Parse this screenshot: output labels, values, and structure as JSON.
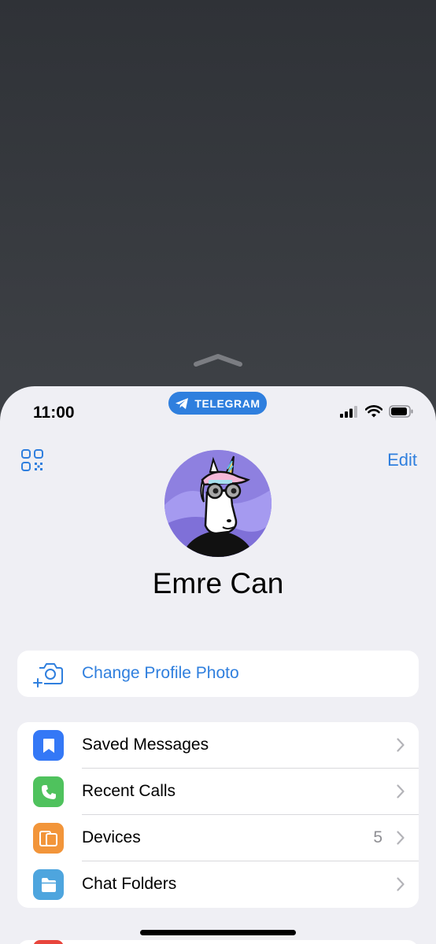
{
  "status_bar": {
    "time": "11:00",
    "app_name": "TELEGRAM"
  },
  "header": {
    "qr_icon": "qr-code-icon",
    "edit_label": "Edit"
  },
  "profile": {
    "name": "Emre Can"
  },
  "change_photo": {
    "label": "Change Profile Photo",
    "icon": "camera-add-icon"
  },
  "menu": {
    "items": [
      {
        "label": "Saved Messages",
        "icon": "bookmark-icon",
        "color": "#3478f6"
      },
      {
        "label": "Recent Calls",
        "icon": "phone-icon",
        "color": "#4fc25d"
      },
      {
        "label": "Devices",
        "icon": "devices-icon",
        "color": "#f2953a",
        "count": "5"
      },
      {
        "label": "Chat Folders",
        "icon": "folder-icon",
        "color": "#4ea5de"
      }
    ]
  },
  "colors": {
    "accent": "#2f7fde",
    "sheet_bg": "#efeff4"
  }
}
